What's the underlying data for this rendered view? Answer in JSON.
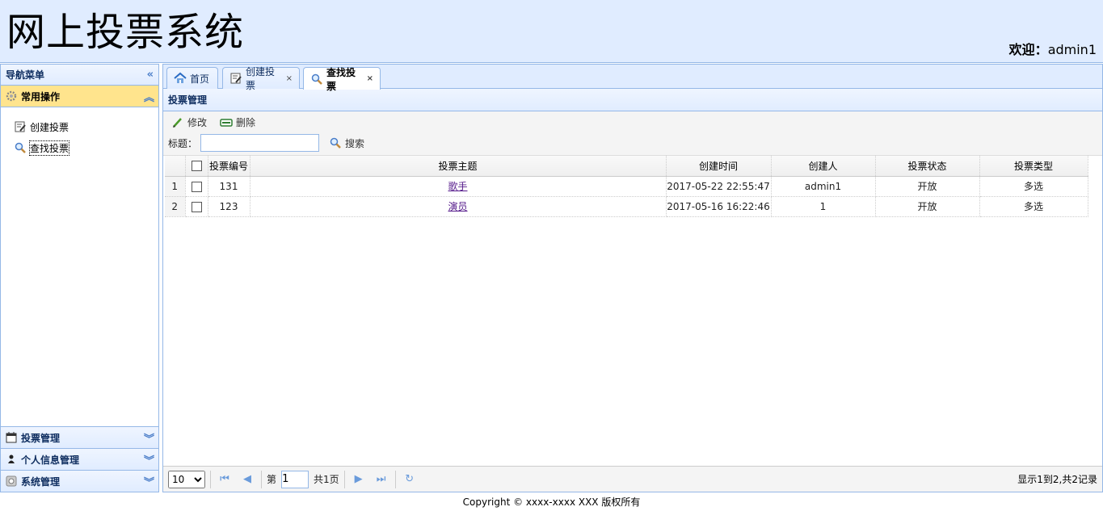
{
  "header": {
    "title": "网上投票系统",
    "welcome_label": "欢迎：",
    "username": "admin1"
  },
  "west": {
    "title": "导航菜单",
    "sections": [
      {
        "label": "常用操作",
        "items": [
          {
            "label": "创建投票"
          },
          {
            "label": "查找投票"
          }
        ]
      },
      {
        "label": "投票管理"
      },
      {
        "label": "个人信息管理"
      },
      {
        "label": "系统管理"
      }
    ]
  },
  "tabs": [
    {
      "label": "首页"
    },
    {
      "label": "创建投票",
      "close": "×"
    },
    {
      "label": "查找投票",
      "close": "×"
    }
  ],
  "grid": {
    "title": "投票管理",
    "edit_label": "修改",
    "delete_label": "删除",
    "search_label": "标题：",
    "search_value": "",
    "search_button": "搜索",
    "columns": [
      "投票编号",
      "投票主题",
      "创建时间",
      "创建人",
      "投票状态",
      "投票类型"
    ],
    "rows": [
      {
        "rownum": "1",
        "id": "131",
        "topic": "歌手",
        "time": "2017-05-22 22:55:47",
        "creator": "admin1",
        "status": "开放",
        "type": "多选"
      },
      {
        "rownum": "2",
        "id": "123",
        "topic": "演员",
        "time": "2017-05-16 16:22:46",
        "creator": "1",
        "status": "开放",
        "type": "多选"
      }
    ]
  },
  "pager": {
    "page_size": "10",
    "page_prefix": "第",
    "page_value": "1",
    "page_total": "共1页",
    "info": "显示1到2,共2记录"
  },
  "footer": {
    "text": "Copyright © xxxx-xxxx XXX 版权所有"
  },
  "colors": {
    "header_bg": "#e0ecff",
    "border": "#95b8e7",
    "active_section": "#ffe48d"
  }
}
